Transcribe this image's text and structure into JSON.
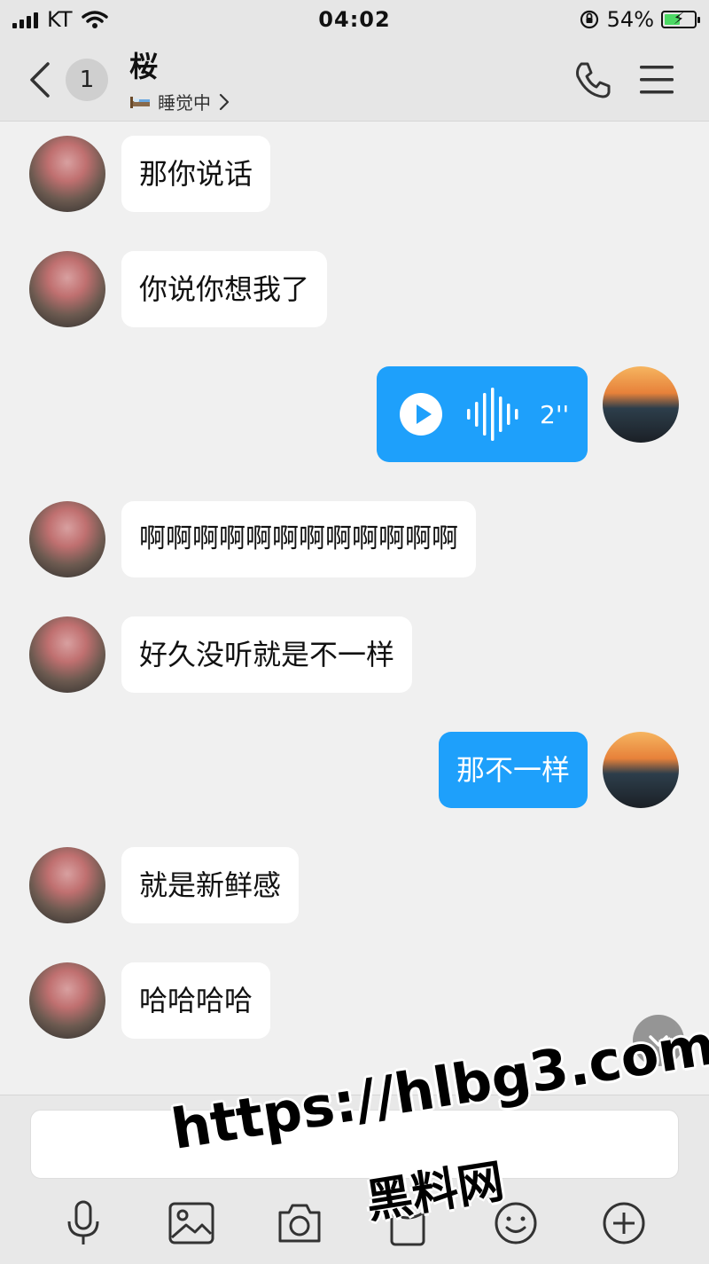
{
  "status_bar": {
    "carrier": "KT",
    "time": "04:02",
    "battery_percent": "54%",
    "battery_level": 0.54,
    "icons": [
      "signal-icon",
      "wifi-icon",
      "orientation-lock-icon",
      "battery-charging-icon"
    ]
  },
  "header": {
    "unread_count": "1",
    "contact_name": "桜",
    "contact_status": "睡觉中",
    "icons": [
      "back-icon",
      "bed-icon",
      "chevron-right-icon",
      "phone-icon",
      "menu-icon"
    ]
  },
  "messages": [
    {
      "sender": "friend",
      "text": "那你说话"
    },
    {
      "sender": "friend",
      "text": "你说你想我了"
    },
    {
      "sender": "me",
      "type": "voice",
      "duration": "2''"
    },
    {
      "sender": "friend",
      "text": "啊啊啊啊啊啊啊啊啊啊啊啊"
    },
    {
      "sender": "friend",
      "text": "好久没听就是不一样"
    },
    {
      "sender": "me",
      "text": "那不一样"
    },
    {
      "sender": "friend",
      "text": "就是新鲜感"
    },
    {
      "sender": "friend",
      "text": "哈哈哈哈"
    }
  ],
  "composer": {
    "input_value": "",
    "tools": [
      "microphone-icon",
      "image-icon",
      "camera-icon",
      "red-packet-icon",
      "emoji-icon",
      "plus-icon"
    ]
  },
  "watermark": {
    "url": "https://hlbg3.com",
    "text": "黑料网"
  },
  "colors": {
    "accent_blue": "#1ea0fb",
    "bubble_in": "#ffffff",
    "background": "#f0f0f0",
    "header": "#e6e6e6"
  }
}
